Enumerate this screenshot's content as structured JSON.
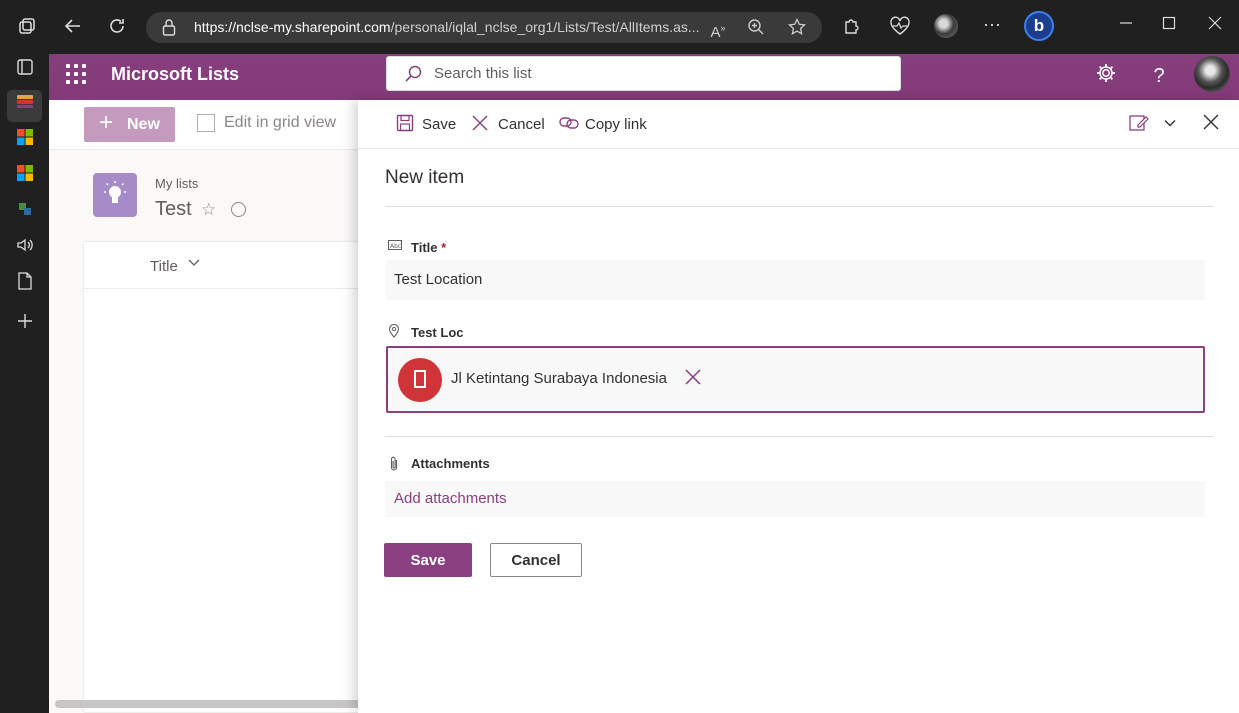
{
  "browser": {
    "url_host": "https://nclse-my.sharepoint.com",
    "url_path": "/personal/iqlal_nclse_org1/Lists/Test/AllItems.as..."
  },
  "suite": {
    "app_title": "Microsoft Lists",
    "search_placeholder": "Search this list"
  },
  "commandbar": {
    "new_label": "New",
    "grid_label": "Edit in grid view"
  },
  "list": {
    "breadcrumb": "My lists",
    "name": "Test",
    "column_title": "Title"
  },
  "panel": {
    "toolbar": {
      "save": "Save",
      "cancel": "Cancel",
      "copy_link": "Copy link"
    },
    "title": "New item",
    "fields": {
      "title_label": "Title",
      "title_required": "*",
      "title_value": "Test Location",
      "loc_label": "Test Loc",
      "loc_value": "Jl Ketintang Surabaya Indonesia",
      "attachments_label": "Attachments",
      "add_attachments": "Add attachments"
    },
    "buttons": {
      "save": "Save",
      "cancel": "Cancel"
    }
  },
  "colors": {
    "brand": "#8a4080",
    "location_pin": "#d13438"
  }
}
